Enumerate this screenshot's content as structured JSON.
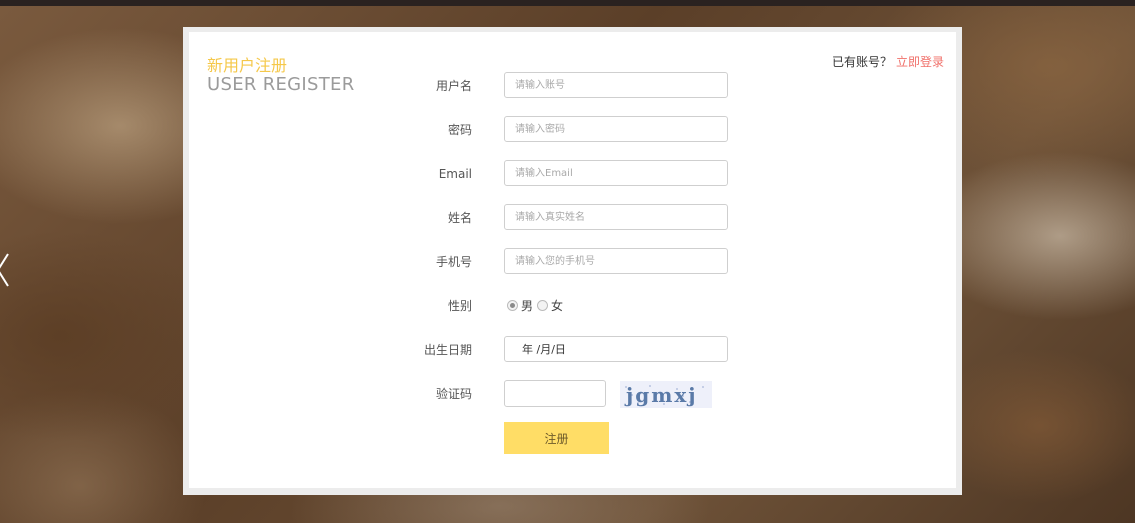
{
  "header": {
    "title_cn": "新用户注册",
    "title_en": "USER REGISTER",
    "have_account": "已有账号？",
    "login_link": "立即登录"
  },
  "form": {
    "username": {
      "label": "用户名",
      "placeholder": "请输入账号"
    },
    "password": {
      "label": "密码",
      "placeholder": "请输入密码"
    },
    "email": {
      "label": "Email",
      "placeholder": "请输入Email"
    },
    "name": {
      "label": "姓名",
      "placeholder": "请输入真实姓名"
    },
    "phone": {
      "label": "手机号",
      "placeholder": "请输入您的手机号"
    },
    "gender": {
      "label": "性别",
      "options": [
        "男",
        "女"
      ],
      "selected": "男"
    },
    "birthday": {
      "label": "出生日期",
      "value": "年 /月/日"
    },
    "captcha": {
      "label": "验证码",
      "image_text": "jgmxj"
    },
    "submit_label": "注册"
  },
  "colors": {
    "accent_yellow": "#ffdd66",
    "title_yellow": "#f5c84a",
    "link_red": "#f0706a"
  },
  "icons": {
    "slide_prev": "chevron-left-icon"
  }
}
